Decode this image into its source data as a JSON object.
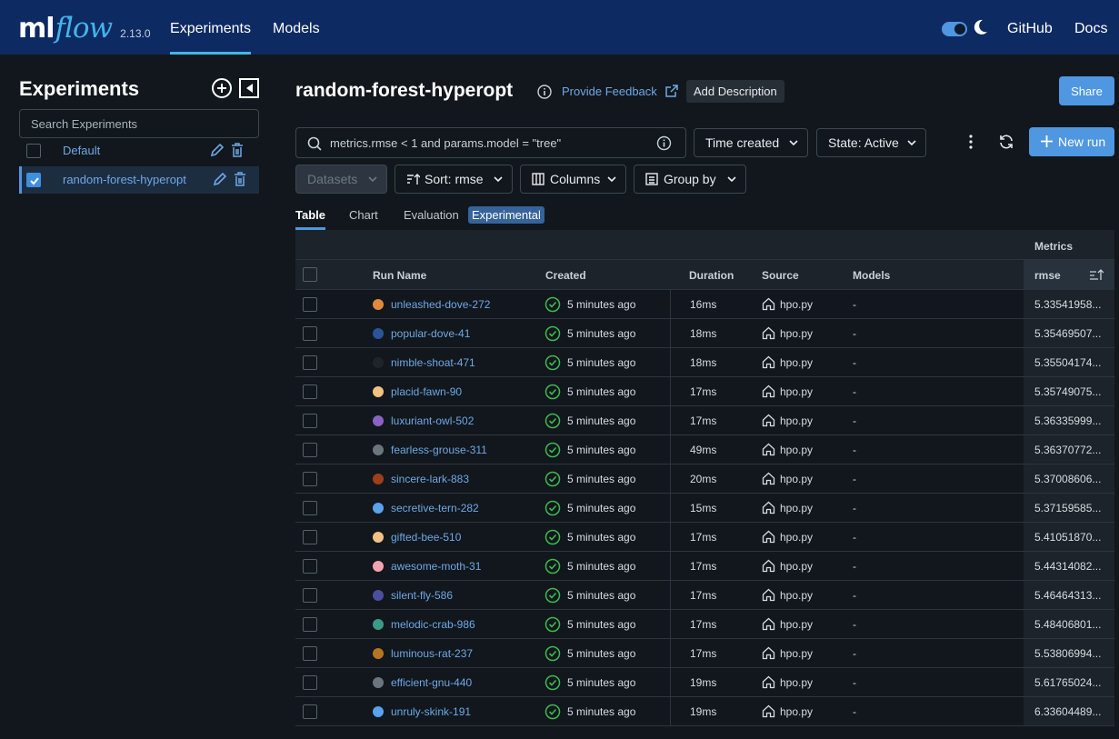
{
  "header": {
    "logo_ml": "ml",
    "logo_flow": "flow",
    "version": "2.13.0",
    "nav": [
      {
        "label": "Experiments",
        "active": true
      },
      {
        "label": "Models",
        "active": false
      }
    ],
    "github": "GitHub",
    "docs": "Docs",
    "dark_mode": true,
    "colors": {
      "bar": "#0e2a63",
      "accent": "#43b5e8"
    }
  },
  "sidebar": {
    "title": "Experiments",
    "search_placeholder": "Search Experiments",
    "experiments": [
      {
        "label": "Default",
        "checked": false
      },
      {
        "label": "random-forest-hyperopt",
        "checked": true
      }
    ]
  },
  "main": {
    "title": "random-forest-hyperopt",
    "feedback": "Provide Feedback",
    "add_description": "Add Description",
    "share": "Share",
    "search_query": "metrics.rmse < 1 and params.model = \"tree\"",
    "time_created": "Time created",
    "state": "State: Active",
    "new_run": "New run",
    "datasets": "Datasets",
    "sort": "Sort: rmse",
    "columns": "Columns",
    "group_by": "Group by",
    "tabs": [
      {
        "label": "Table",
        "active": true
      },
      {
        "label": "Chart",
        "active": false
      },
      {
        "label": "Evaluation",
        "active": false
      }
    ],
    "experimental_badge": "Experimental"
  },
  "table": {
    "group_header": "Metrics",
    "headers": {
      "run_name": "Run Name",
      "created": "Created",
      "duration": "Duration",
      "source": "Source",
      "models": "Models",
      "rmse": "rmse"
    },
    "rows": [
      {
        "name": "unleashed-dove-272",
        "color": "#e08a3c",
        "created": "5 minutes ago",
        "duration": "16ms",
        "source": "hpo.py",
        "models": "-",
        "rmse": "5.33541958..."
      },
      {
        "name": "popular-dove-41",
        "color": "#2b5499",
        "created": "5 minutes ago",
        "duration": "18ms",
        "source": "hpo.py",
        "models": "-",
        "rmse": "5.35469507..."
      },
      {
        "name": "nimble-shoat-471",
        "color": "#1e242a",
        "created": "5 minutes ago",
        "duration": "18ms",
        "source": "hpo.py",
        "models": "-",
        "rmse": "5.35504174..."
      },
      {
        "name": "placid-fawn-90",
        "color": "#f2c184",
        "created": "5 minutes ago",
        "duration": "17ms",
        "source": "hpo.py",
        "models": "-",
        "rmse": "5.35749075..."
      },
      {
        "name": "luxuriant-owl-502",
        "color": "#8a62c4",
        "created": "5 minutes ago",
        "duration": "17ms",
        "source": "hpo.py",
        "models": "-",
        "rmse": "5.36335999..."
      },
      {
        "name": "fearless-grouse-311",
        "color": "#6b7580",
        "created": "5 minutes ago",
        "duration": "49ms",
        "source": "hpo.py",
        "models": "-",
        "rmse": "5.36370772..."
      },
      {
        "name": "sincere-lark-883",
        "color": "#9c3f1c",
        "created": "5 minutes ago",
        "duration": "20ms",
        "source": "hpo.py",
        "models": "-",
        "rmse": "5.37008606..."
      },
      {
        "name": "secretive-tern-282",
        "color": "#5aa2ea",
        "created": "5 minutes ago",
        "duration": "15ms",
        "source": "hpo.py",
        "models": "-",
        "rmse": "5.37159585..."
      },
      {
        "name": "gifted-bee-510",
        "color": "#f2c184",
        "created": "5 minutes ago",
        "duration": "17ms",
        "source": "hpo.py",
        "models": "-",
        "rmse": "5.41051870..."
      },
      {
        "name": "awesome-moth-31",
        "color": "#f2a3b0",
        "created": "5 minutes ago",
        "duration": "17ms",
        "source": "hpo.py",
        "models": "-",
        "rmse": "5.44314082..."
      },
      {
        "name": "silent-fly-586",
        "color": "#4b4fa0",
        "created": "5 minutes ago",
        "duration": "17ms",
        "source": "hpo.py",
        "models": "-",
        "rmse": "5.46464313..."
      },
      {
        "name": "melodic-crab-986",
        "color": "#3a9a8a",
        "created": "5 minutes ago",
        "duration": "17ms",
        "source": "hpo.py",
        "models": "-",
        "rmse": "5.48406801..."
      },
      {
        "name": "luminous-rat-237",
        "color": "#b67522",
        "created": "5 minutes ago",
        "duration": "17ms",
        "source": "hpo.py",
        "models": "-",
        "rmse": "5.53806994..."
      },
      {
        "name": "efficient-gnu-440",
        "color": "#6b7580",
        "created": "5 minutes ago",
        "duration": "19ms",
        "source": "hpo.py",
        "models": "-",
        "rmse": "5.61765024..."
      },
      {
        "name": "unruly-skink-191",
        "color": "#5aa2ea",
        "created": "5 minutes ago",
        "duration": "19ms",
        "source": "hpo.py",
        "models": "-",
        "rmse": "6.33604489..."
      }
    ]
  }
}
